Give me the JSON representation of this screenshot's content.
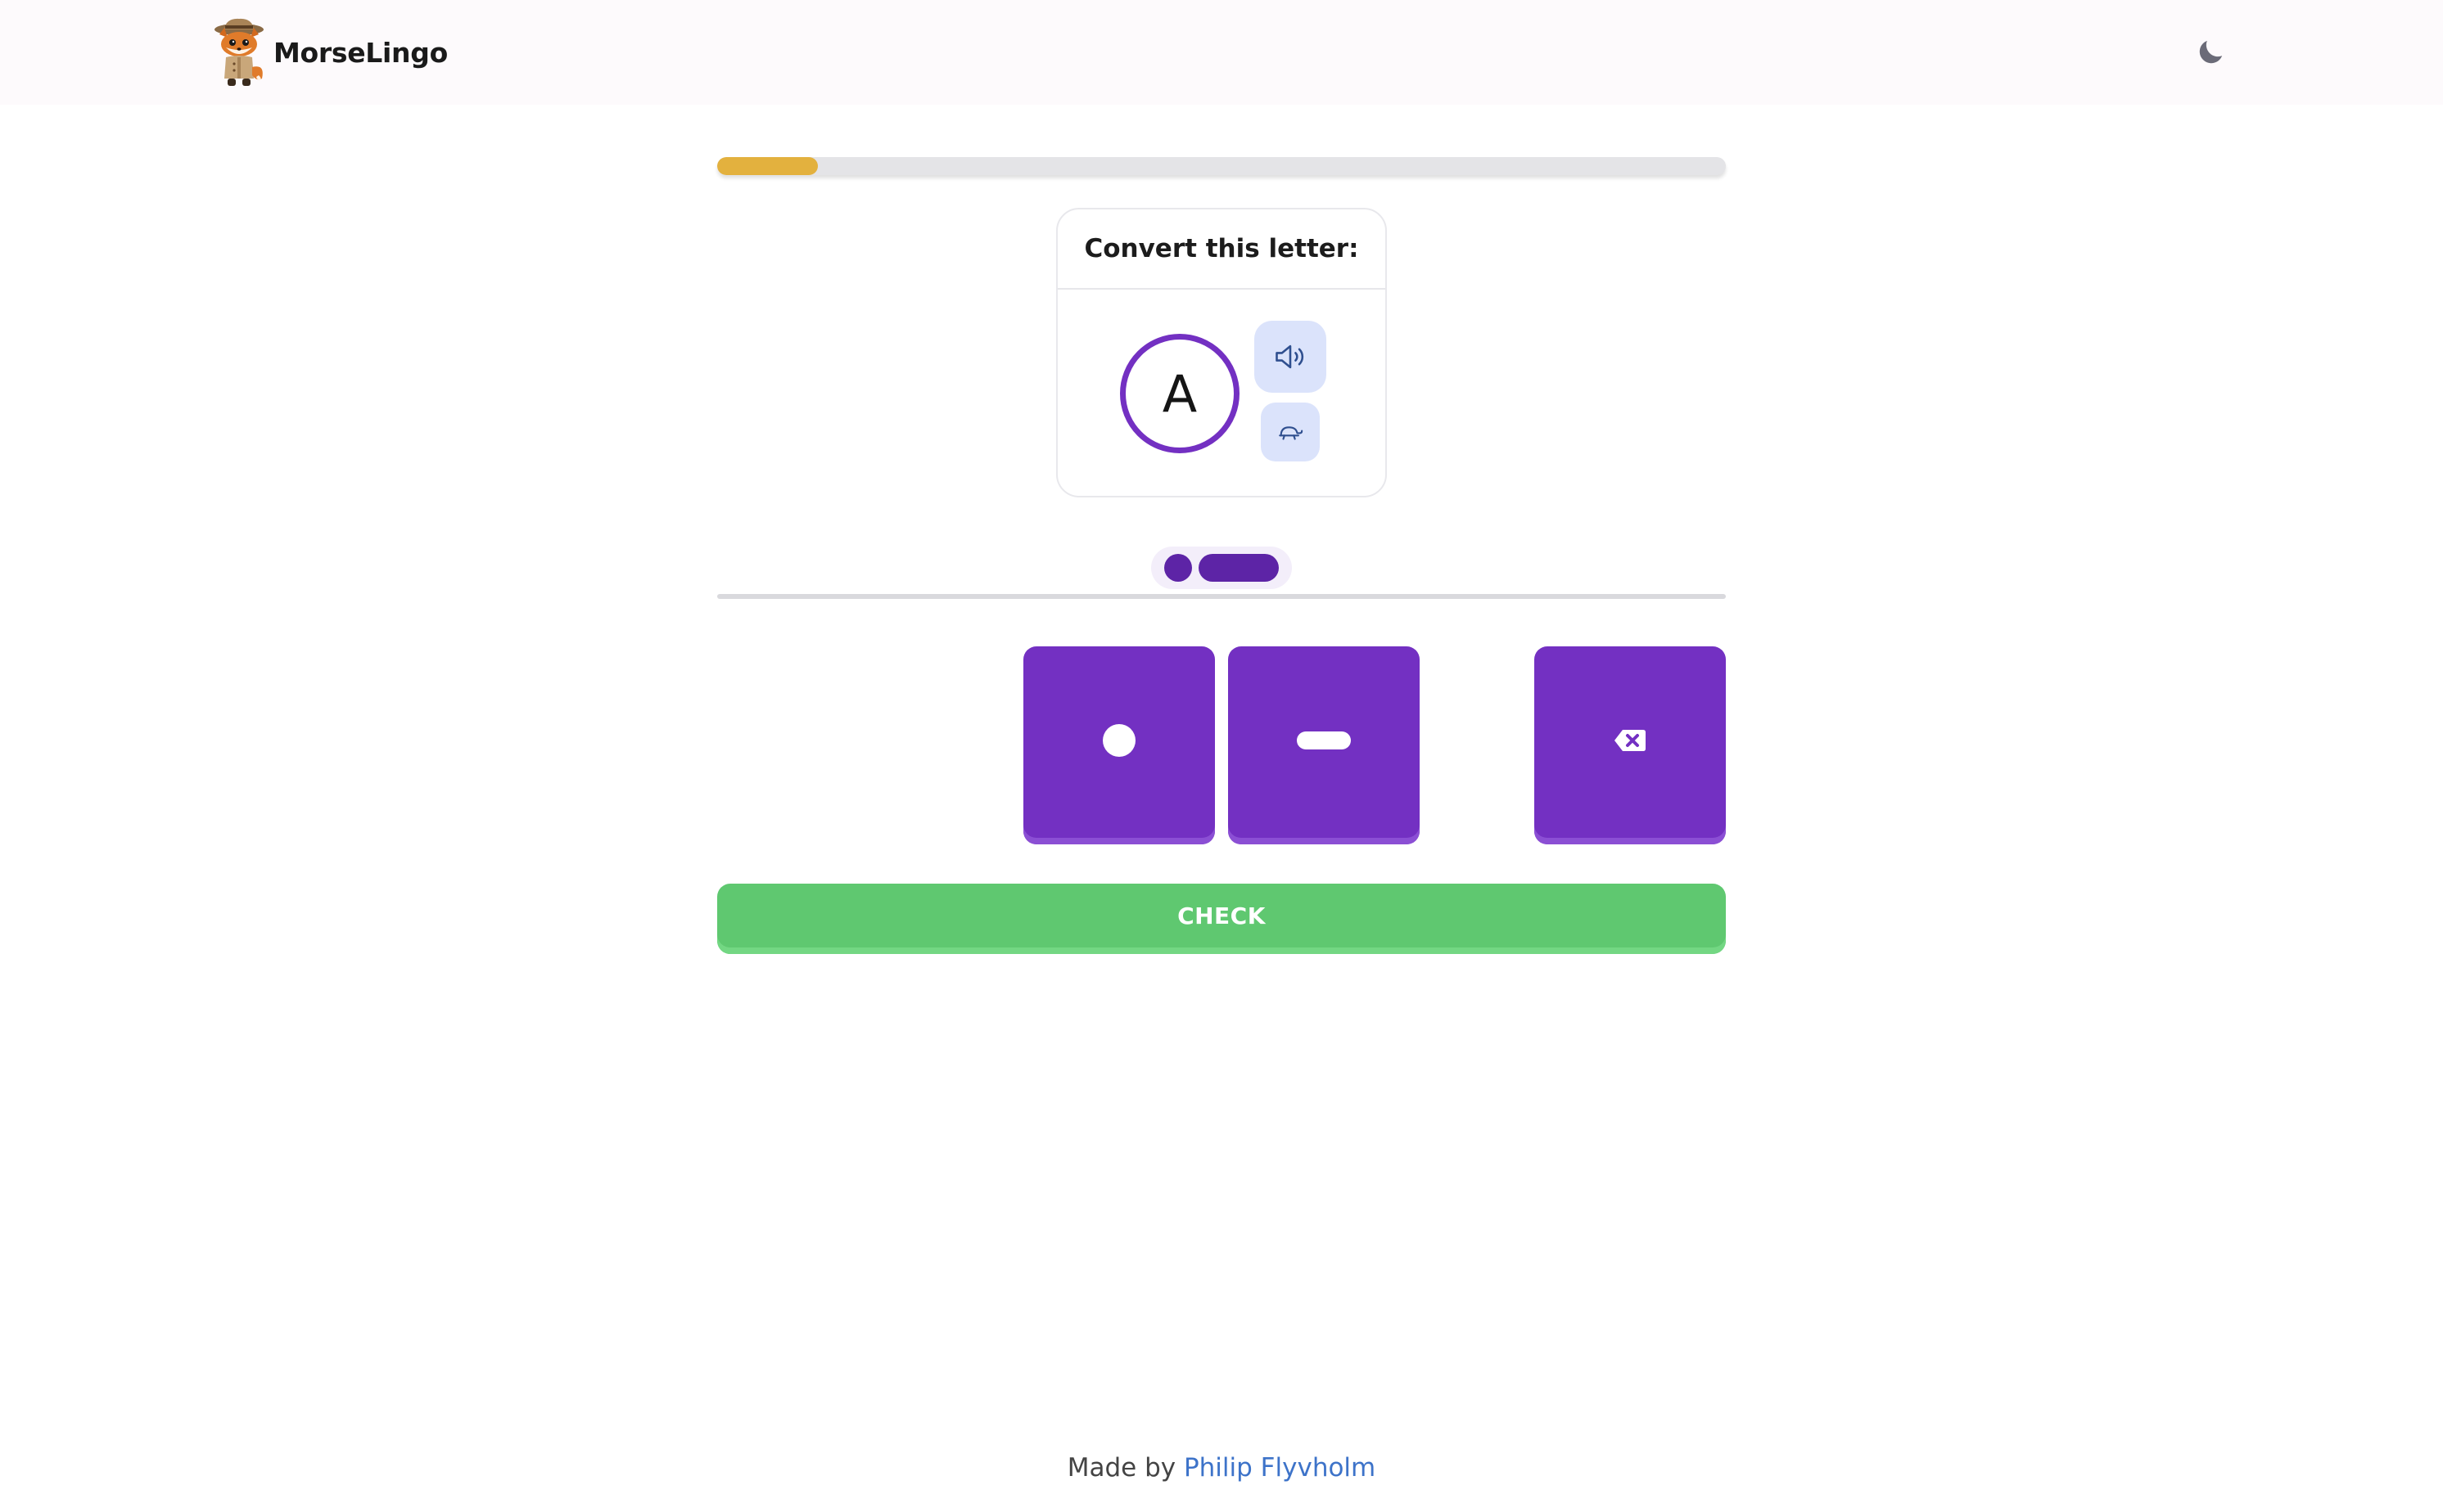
{
  "app": {
    "name": "MorseLingo"
  },
  "header": {
    "theme_toggle_icon": "moon-icon"
  },
  "progress": {
    "fraction": 0.1
  },
  "prompt": {
    "instruction": "Convert this letter:",
    "letter": "A",
    "sound_icon": "speaker-icon",
    "slow_icon": "turtle-icon"
  },
  "answer": {
    "symbols": [
      "dot",
      "dash"
    ]
  },
  "keys": {
    "dot_icon": "dot-icon",
    "dash_icon": "dash-icon",
    "backspace_icon": "backspace-icon"
  },
  "check_label": "CHECK",
  "footer": {
    "prefix": "Made by",
    "author": "Philip Flyvholm"
  },
  "colors": {
    "accent": "#7330c2",
    "progress": "#e3b13e",
    "check": "#5fc870",
    "link": "#3d73c9"
  }
}
